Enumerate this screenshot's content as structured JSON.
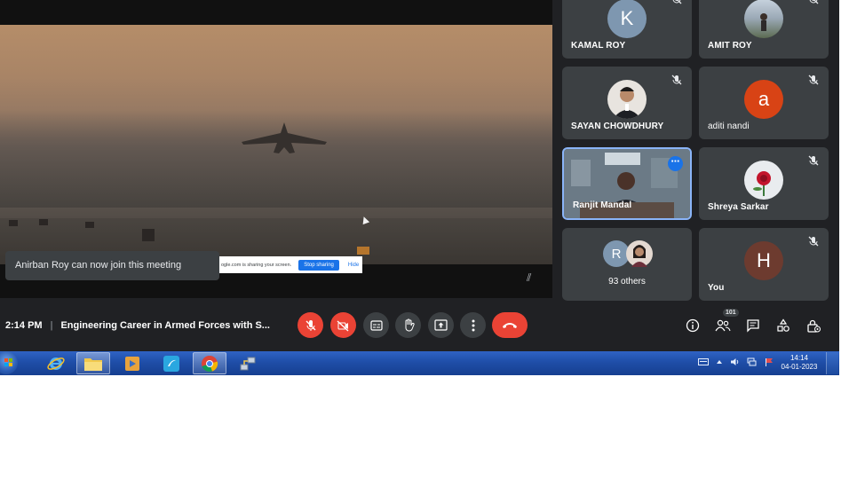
{
  "toast": {
    "text": "Anirban Roy can now join this meeting"
  },
  "share_banner": {
    "text": "ogle.com is sharing your screen.",
    "stop_label": "Stop sharing",
    "hide_label": "Hide"
  },
  "participants": [
    {
      "name": "KAMAL ROY",
      "initial": "K",
      "avatar_color": "#7e97b0",
      "muted": true
    },
    {
      "name": "AMIT ROY",
      "initial": "",
      "avatar_color": "#9aa5b1",
      "muted": true
    },
    {
      "name": "SAYAN CHOWDHURY",
      "initial": "",
      "avatar_color": "#e8e4df",
      "muted": true
    },
    {
      "name": "aditi nandi",
      "initial": "a",
      "avatar_color": "#d84315",
      "muted": true
    },
    {
      "name": "Ranjit Mandal",
      "initial": "",
      "avatar_color": "#5a6670",
      "muted": false
    },
    {
      "name": "Shreya Sarkar",
      "initial": "",
      "avatar_color": "#e9ecef",
      "muted": true
    },
    {
      "name": "You",
      "initial": "H",
      "avatar_color": "#6d3b2f",
      "muted": true
    }
  ],
  "others": {
    "label": "93 others",
    "initial": "R",
    "initial_color": "#7e97b0"
  },
  "meeting": {
    "time": "2:14 PM",
    "separator": "|",
    "title": "Engineering Career in Armed Forces with S..."
  },
  "controls": {
    "icons": [
      "mic-off-icon",
      "camera-off-icon",
      "captions-icon",
      "raise-hand-icon",
      "present-icon",
      "more-options-icon",
      "hang-up-icon"
    ],
    "right_icons": [
      "info-icon",
      "people-icon",
      "chat-icon",
      "activities-icon",
      "host-controls-icon"
    ],
    "people_count": "101"
  },
  "taskbar": {
    "apps": [
      "internet-explorer-icon",
      "file-explorer-icon",
      "media-player-icon",
      "app-icon",
      "chrome-icon",
      "network-app-icon"
    ],
    "time": "14:14",
    "date": "04-01-2023",
    "accent": "#1f4ea8"
  },
  "colors": {
    "background": "#202124",
    "tile": "#3c4043",
    "danger": "#ea4335",
    "accent": "#1a73e8"
  }
}
